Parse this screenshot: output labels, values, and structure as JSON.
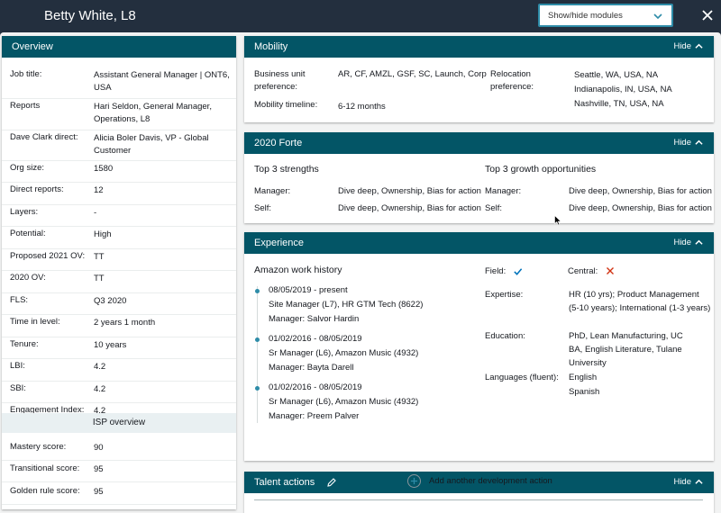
{
  "header": {
    "person_title": "Betty White, L8",
    "module_select": "Show/hide modules"
  },
  "overview": {
    "title": "Overview",
    "rows": [
      {
        "key": "Job title:",
        "value": "Assistant General Manager | ONT6, USA"
      },
      {
        "key": "Reports",
        "value": "Hari Seldon, General Manager, Operations, L8"
      },
      {
        "key": "Dave Clark direct:",
        "value": "Alicia Boler Davis, VP - Global Customer"
      },
      {
        "key": "Org size:",
        "value": "1580"
      },
      {
        "key": "Direct reports:",
        "value": "12"
      },
      {
        "key": "Layers:",
        "value": "-"
      },
      {
        "key": "Potential:",
        "value": "High"
      },
      {
        "key": "Proposed 2021 OV:",
        "value": "TT"
      },
      {
        "key": "2020 OV:",
        "value": "TT"
      },
      {
        "key": "FLS:",
        "value": "Q3 2020"
      },
      {
        "key": "Time in level:",
        "value": "2 years 1 month"
      },
      {
        "key": "Tenure:",
        "value": "10 years"
      },
      {
        "key": "LBI:",
        "value": "4.2"
      },
      {
        "key": "SBI:",
        "value": "4.2"
      },
      {
        "key": "Engagement Index:",
        "value": "4.2"
      }
    ],
    "isp_title": "ISP overview",
    "isp_rows": [
      {
        "key": "Mastery score:",
        "value": "90"
      },
      {
        "key": "Transitional score:",
        "value": "95"
      },
      {
        "key": "Golden rule score:",
        "value": "95"
      }
    ]
  },
  "hide_label": "Hide",
  "mobility": {
    "title": "Mobility",
    "bu_pref_label_1": "Business unit",
    "bu_pref_label_2": "preference:",
    "bu_pref_value": "AR, CF, AMZL, GSF, SC, Launch, Corp",
    "timeline_label": "Mobility timeline:",
    "timeline_value": "6-12 months",
    "reloc_label_1": "Relocation",
    "reloc_label_2": "preference:",
    "reloc_values": [
      "Seattle, WA, USA, NA",
      "Indianapolis, IN, USA, NA",
      "Nashville, TN, USA, NA"
    ]
  },
  "forte": {
    "title": "2020 Forte",
    "strengths_title": "Top 3 strengths",
    "growth_title": "Top 3 growth opportunities",
    "manager_label": "Manager:",
    "self_label": "Self:",
    "strengths_manager": "Dive deep, Ownership, Bias for action",
    "strengths_self": "Dive deep, Ownership, Bias for action",
    "growth_manager": "Dive deep, Ownership, Bias for action",
    "growth_self": "Dive deep, Ownership, Bias for action"
  },
  "experience": {
    "title": "Experience",
    "history_title": "Amazon work history",
    "history": [
      {
        "dates": "08/05/2019 - present",
        "role": "Site Manager (L7), HR GTM Tech (8622)",
        "manager": "Manager: Salvor Hardin"
      },
      {
        "dates": "01/02/2016 - 08/05/2019",
        "role": "Sr Manager (L6), Amazon Music (4932)",
        "manager": "Manager: Bayta Darell"
      },
      {
        "dates": "01/02/2016 - 08/05/2019",
        "role": "Sr Manager (L6), Amazon Music (4932)",
        "manager": "Manager: Preem Palver"
      }
    ],
    "field_label": "Field:",
    "central_label": "Central:",
    "expertise_label": "Expertise:",
    "expertise_lines": [
      "HR (10 yrs); Product Management",
      "(5-10 years); International (1-3 years)"
    ],
    "education_label": "Education:",
    "education_lines": [
      "PhD, Lean Manufacturing, UC",
      "BA, English Literature, Tulane University"
    ],
    "languages_label": "Languages (fluent):",
    "languages": [
      "English",
      "Spanish"
    ]
  },
  "talent": {
    "title": "Talent actions",
    "add_label": "Add another development action"
  },
  "colors": {
    "header_bg": "#232f3e",
    "panel_header": "#035566",
    "accent": "#2e8ca8",
    "check": "#0073bb",
    "cross": "#d13212"
  }
}
